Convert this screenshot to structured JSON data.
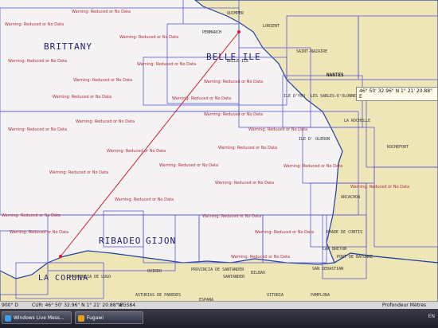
{
  "map": {
    "region_labels": [
      "BRITTANY",
      "BELLE ILE",
      "RIBADEO",
      "GIJON",
      "LA CORUNA"
    ],
    "city_labels": [
      "NANTES",
      "QUIMPER",
      "LORIENT",
      "PENMARCH",
      "ILE D'YEU",
      "LES SABLES-D'OLONNE",
      "LA ROCHELLE",
      "ILE D' OLERON",
      "ARCACHON",
      "PORT DE BAYONNE",
      "CAP BRETON",
      "SAN SEBASTIAN",
      "PHARE DE CONTIS",
      "BILBAO",
      "VITORIA",
      "PAMPLONA",
      "ESPANA",
      "SANTANDER",
      "OVIEDO",
      "PROVINCIA DE LUGO",
      "PROVINCIA DE SANTANDER",
      "ASTURIAS DE PAREDES",
      "SAINT-NAZAIRE",
      "BELLE-ILE",
      "ROCHEFORT"
    ],
    "warning_text": "Warning: Reduced or No Data",
    "coordinate_tooltip": "46° 50' 32.96\" N 1° 21' 20.88\" E"
  },
  "statusbar": {
    "left_value": "900° D",
    "cursor_readout": "CUR: 46° 50' 32.96\" N 1° 21' 20.88\" E",
    "datum": "WGS84",
    "right_text": "Profondeur Mètres"
  },
  "taskbar": {
    "items": [
      {
        "label": "Windows Live Mess...",
        "icon": "messenger-icon",
        "color": "#3aa0e8"
      },
      {
        "label": "Fugawi",
        "icon": "fugawi-icon",
        "color": "#e0a020"
      }
    ],
    "tray_text": "EN"
  },
  "colors": {
    "land": "#efe6b8",
    "water": "#f4f2f2",
    "chart_outline": "#5a5ad8",
    "route": "#d02030",
    "coast": "#2040a0"
  }
}
